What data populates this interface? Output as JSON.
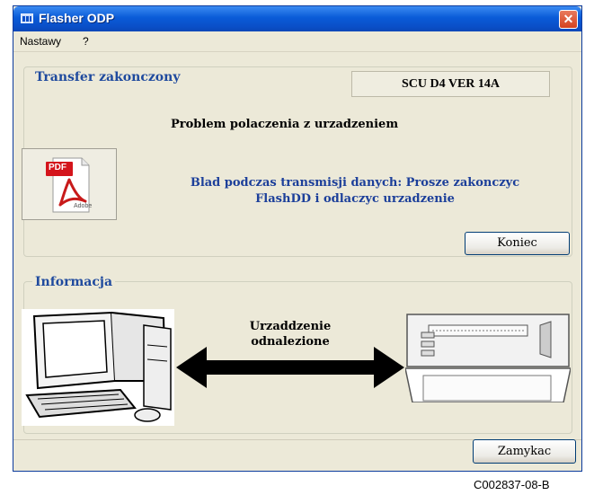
{
  "window": {
    "title": "Flasher ODP",
    "close_symbol": "✕"
  },
  "menu": {
    "items": [
      "Nastawy",
      "?"
    ]
  },
  "transfer_group": {
    "legend": "Transfer zakonczony",
    "status": "SCU D4 VER  14A",
    "error_title": "Problem polaczenia z urzadzeniem",
    "message_line1": "Blad podczas transmisji danych: Prosze zakonczyc",
    "message_line2": "FlashDD i odlaczyc urzadzenie",
    "pdf_label": "PDF",
    "adobe_label": "Adobe",
    "button_label": "Koniec"
  },
  "info_group": {
    "legend": "Informacja",
    "status_line1": "Urzaddzenie",
    "status_line2": "odnalezione"
  },
  "footer": {
    "close_button": "Zamykac"
  },
  "figure_caption": "C002837-08-B"
}
